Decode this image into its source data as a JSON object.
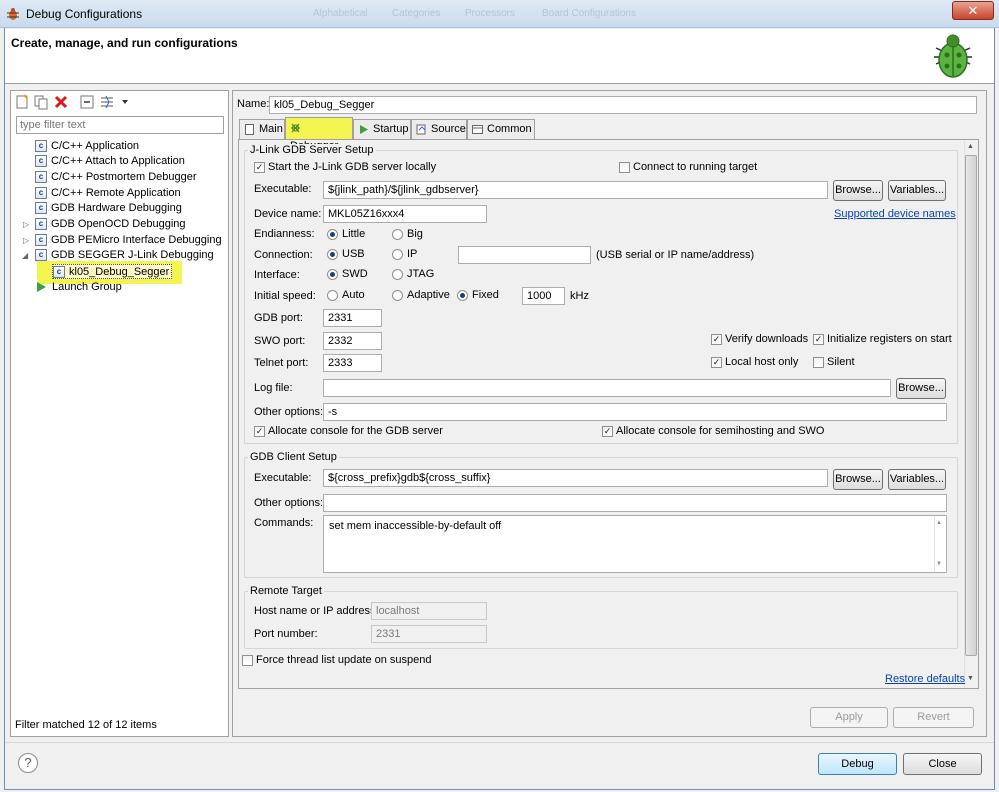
{
  "window": {
    "title": "Debug Configurations",
    "close_glyph": "✕",
    "ghost_tabs": [
      "Alphabetical",
      "Categories",
      "Processors",
      "Board Configurations"
    ]
  },
  "banner": {
    "title": "Create, manage, and run configurations"
  },
  "left": {
    "filter_placeholder": "type filter text",
    "tree": [
      {
        "label": "C/C++ Application",
        "icon": "c-config-icon"
      },
      {
        "label": "C/C++ Attach to Application",
        "icon": "c-config-icon"
      },
      {
        "label": "C/C++ Postmortem Debugger",
        "icon": "c-config-icon"
      },
      {
        "label": "C/C++ Remote Application",
        "icon": "c-config-icon"
      },
      {
        "label": "GDB Hardware Debugging",
        "icon": "c-config-icon"
      },
      {
        "label": "GDB OpenOCD Debugging",
        "icon": "c-config-icon"
      },
      {
        "label": "GDB PEMicro Interface Debugging",
        "icon": "c-config-icon"
      },
      {
        "label": "GDB SEGGER J-Link Debugging",
        "icon": "c-config-icon"
      },
      {
        "label": "kl05_Debug_Segger",
        "icon": "c-config-icon"
      },
      {
        "label": "Launch Group",
        "icon": "launch-group-icon"
      }
    ],
    "filter_status": "Filter matched 12 of 12 items"
  },
  "config": {
    "name_label": "Name:",
    "name_value": "kl05_Debug_Segger",
    "tabs": [
      "Main",
      "Debugger",
      "Startup",
      "Source",
      "Common"
    ],
    "active_tab": "Debugger"
  },
  "server": {
    "group_title": "J-Link GDB Server Setup",
    "start_locally": "Start the J-Link GDB server locally",
    "connect_running": "Connect to running target",
    "executable_label": "Executable:",
    "executable_value": "${jlink_path}/${jlink_gdbserver}",
    "browse": "Browse...",
    "variables": "Variables...",
    "device_label": "Device name:",
    "device_value": "MKL05Z16xxx4",
    "supported_link": "Supported device names",
    "endianness_label": "Endianness:",
    "little": "Little",
    "big": "Big",
    "connection_label": "Connection:",
    "usb": "USB",
    "ip": "IP",
    "ip_value": "",
    "ip_hint": "(USB serial or IP name/address)",
    "interface_label": "Interface:",
    "swd": "SWD",
    "jtag": "JTAG",
    "speed_label": "Initial speed:",
    "auto": "Auto",
    "adaptive": "Adaptive",
    "fixed": "Fixed",
    "speed_value": "1000",
    "khz": "kHz",
    "gdb_port_label": "GDB port:",
    "gdb_port": "2331",
    "swo_port_label": "SWO port:",
    "swo_port": "2332",
    "telnet_port_label": "Telnet port:",
    "telnet_port": "2333",
    "verify_downloads": "Verify downloads",
    "init_registers": "Initialize registers on start",
    "local_host_only": "Local host only",
    "silent": "Silent",
    "log_label": "Log file:",
    "log_value": "",
    "other_label": "Other options:",
    "other_value": "-s",
    "alloc_gdb": "Allocate console for the GDB server",
    "alloc_semi": "Allocate console for semihosting and SWO"
  },
  "client": {
    "group_title": "GDB Client Setup",
    "executable_label": "Executable:",
    "executable_value": "${cross_prefix}gdb${cross_suffix}",
    "browse": "Browse...",
    "variables": "Variables...",
    "other_label": "Other options:",
    "other_value": "",
    "commands_label": "Commands:",
    "commands_value": "set mem inaccessible-by-default off"
  },
  "remote": {
    "group_title": "Remote Target",
    "host_label": "Host name or IP address:",
    "host_value": "localhost",
    "port_label": "Port number:",
    "port_value": "2331"
  },
  "force_thread": "Force thread list update on suspend",
  "restore_defaults": "Restore defaults",
  "apply": "Apply",
  "revert": "Revert",
  "debug": "Debug",
  "close": "Close",
  "help_glyph": "?",
  "check_glyph": "✓"
}
